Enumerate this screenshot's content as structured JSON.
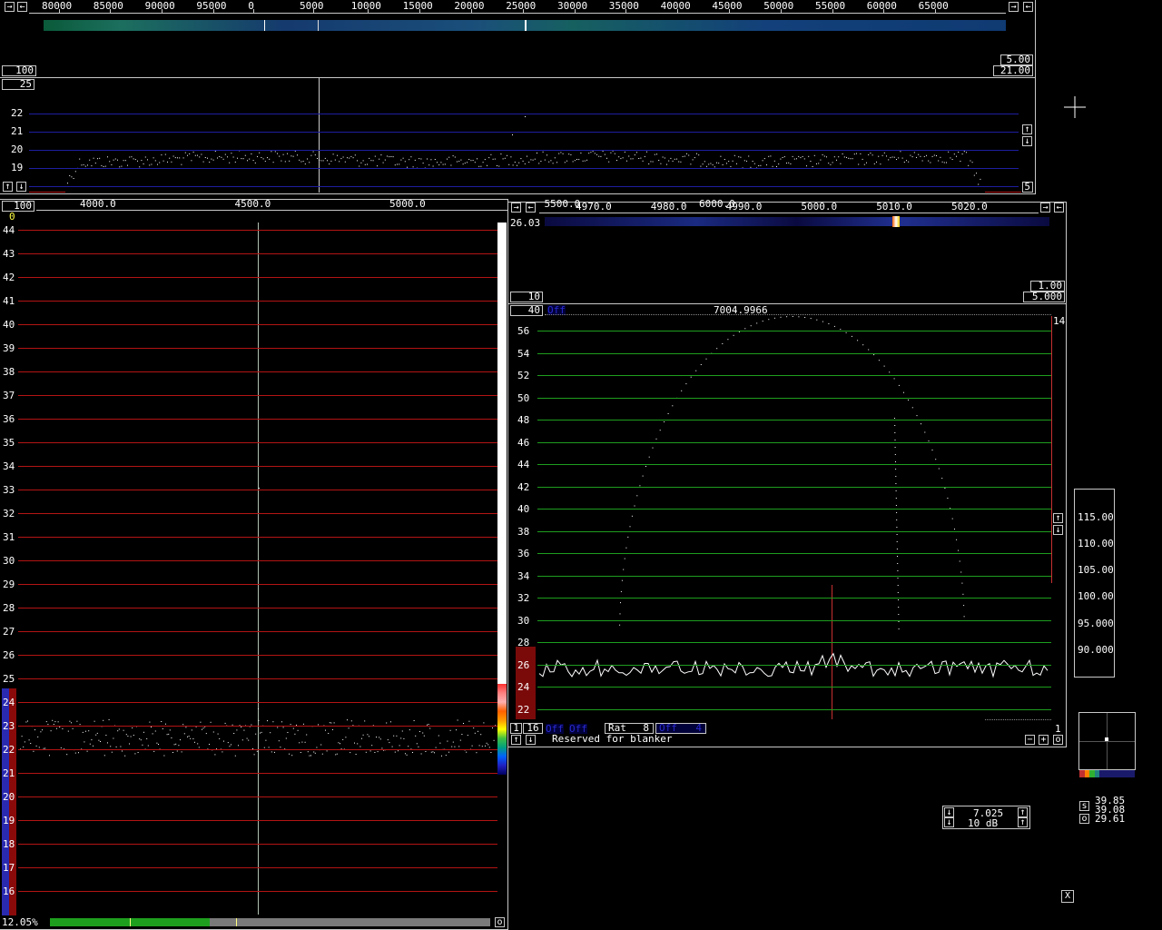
{
  "colors": {
    "red_line": "#b41414",
    "green_line": "#1e9e1e",
    "blue_line": "#1e1ea0",
    "axis": "#c8c8c8"
  },
  "top_spectrum": {
    "freq_ticks": [
      "80000",
      "85000",
      "90000",
      "95000",
      "0",
      "5000",
      "10000",
      "15000",
      "20000",
      "25000",
      "30000",
      "35000",
      "40000",
      "45000",
      "50000",
      "55000",
      "60000",
      "65000"
    ],
    "box_left": "100",
    "box_right_top": "5.00",
    "box_right_bottom": "21.00"
  },
  "avg_spectrum": {
    "box_top_left": "25",
    "box_bottom_right": "5",
    "y_labels": [
      "22",
      "21",
      "20",
      "19"
    ]
  },
  "baseband": {
    "box_top_left": "100",
    "zero_label": "0",
    "freq_ticks": [
      "4000.0",
      "4500.0",
      "5000.0",
      "5500.0",
      "6000.0"
    ],
    "y_labels": [
      "44",
      "43",
      "42",
      "41",
      "40",
      "39",
      "38",
      "37",
      "36",
      "35",
      "34",
      "33",
      "32",
      "31",
      "30",
      "29",
      "28",
      "27",
      "26",
      "25",
      "24",
      "23",
      "22",
      "21",
      "20",
      "19",
      "18",
      "17",
      "16"
    ],
    "percent": "12.05%",
    "bottom_o": "o"
  },
  "hires_waterfall": {
    "freq_ticks": [
      "4970.0",
      "4980.0",
      "4990.0",
      "5000.0",
      "5010.0",
      "5020.0"
    ],
    "left_value": "26.03",
    "box_bottom_left": "10",
    "box_right_top": "1.00",
    "box_right_bottom": "5.000"
  },
  "hires_graph": {
    "box_top_left": "40",
    "off_label": "Off",
    "center_freq": "7004.9966",
    "y_labels": [
      "56",
      "54",
      "52",
      "50",
      "48",
      "46",
      "44",
      "42",
      "40",
      "38",
      "36",
      "34",
      "32",
      "30",
      "28",
      "26",
      "24",
      "22"
    ],
    "right_num": "14",
    "ctrl_1": "1",
    "ctrl_16": "16",
    "off1": "Off",
    "off2": "Off",
    "rat_label": "Rat",
    "rat_value": "8",
    "off3": "Off",
    "off3_value": "4",
    "right_one": "1",
    "blanker_text": "Reserved for blanker",
    "minus": "−",
    "plus": "+",
    "o": "o"
  },
  "smeter": {
    "values": [
      "115.00",
      "110.00",
      "105.00",
      "100.00",
      "95.000",
      "90.000"
    ]
  },
  "freq_control": {
    "freq": "7.025",
    "gain": "10 dB"
  },
  "signal": {
    "s_label": "s",
    "o_label": "o",
    "v1": "39.85",
    "v2": "39.08",
    "v3": "29.61"
  },
  "close_icon": "X"
}
